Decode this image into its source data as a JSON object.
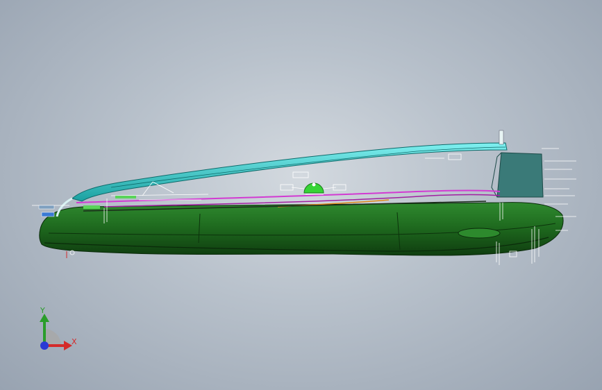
{
  "viewport": {
    "background_top": "#d3d9df",
    "background_bottom": "#98a3b1"
  },
  "model": {
    "body_color": "#1f6b1f",
    "body_dark": "#0f3d0f",
    "rail_color": "#36cfcf",
    "panel_color": "#3a7a78",
    "curve_magenta": "#d23ad2",
    "curve_orange": "#e08a1a",
    "marker_green": "#36d436"
  },
  "triad": {
    "x_label": "X",
    "y_label": "Y",
    "x_color": "#d42a2a",
    "y_color": "#2a9d2a",
    "z_color": "#2a3ad4"
  }
}
